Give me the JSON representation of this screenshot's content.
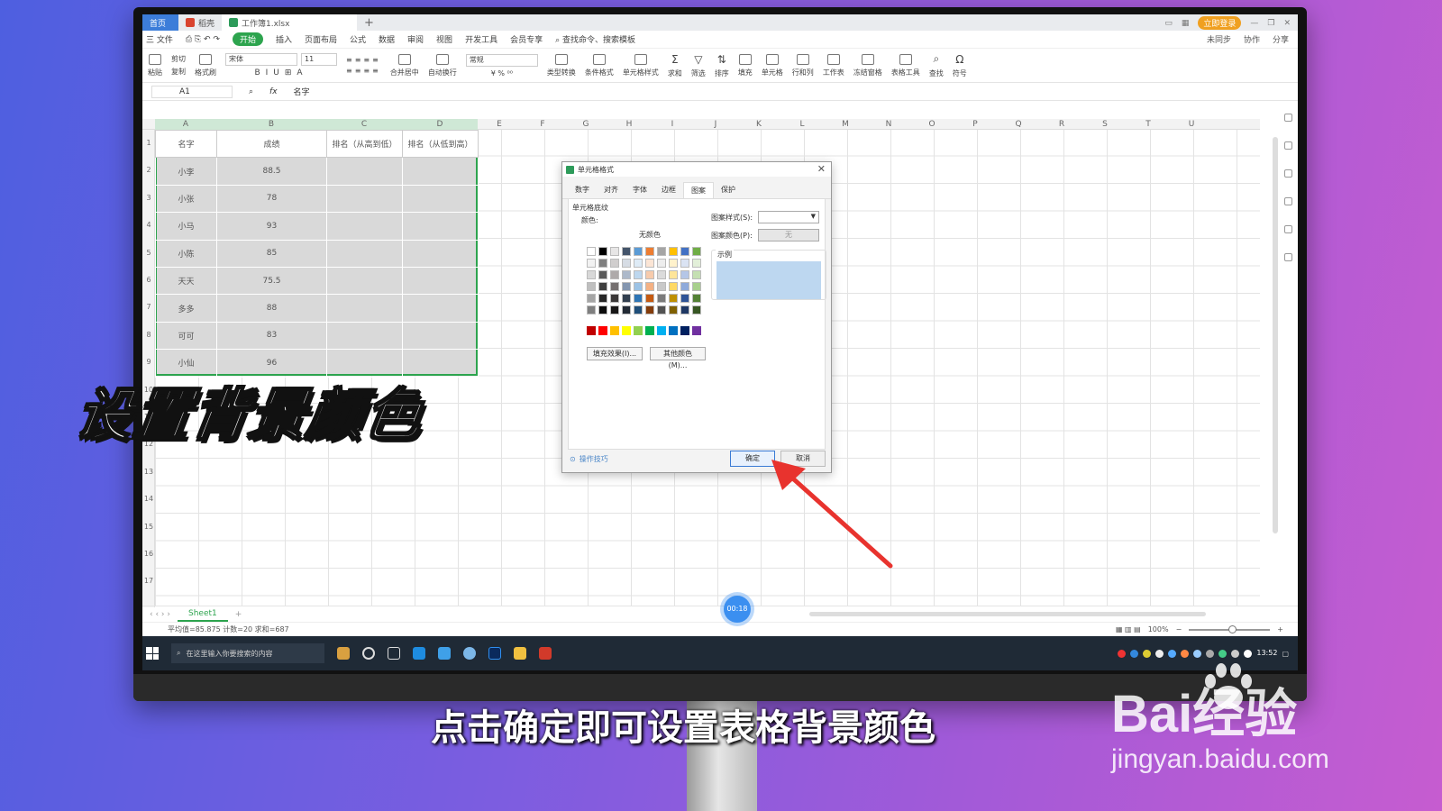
{
  "tabs": [
    {
      "label": "首页"
    },
    {
      "label": "稻壳"
    },
    {
      "label": "工作簿1.xlsx"
    }
  ],
  "window": {
    "login_label": "立即登录"
  },
  "menu": {
    "items": [
      "三 文件",
      "开始",
      "插入",
      "页面布局",
      "公式",
      "数据",
      "审阅",
      "视图",
      "开发工具",
      "会员专享"
    ],
    "search_placeholder": "查找命令、搜索模板",
    "right": [
      "未同步",
      "协作",
      "分享"
    ]
  },
  "ribbon": {
    "items": [
      "粘贴",
      "剪切",
      "复制",
      "格式刷",
      "合并居中",
      "自动换行",
      "类型转换",
      "条件格式",
      "单元格样式",
      "求和",
      "筛选",
      "排序",
      "填充",
      "单元格",
      "行和列",
      "工作表",
      "冻结窗格",
      "表格工具",
      "查找",
      "符号"
    ],
    "font_name": "宋体",
    "font_size": "11",
    "number_format": "常规"
  },
  "formula": {
    "namebox": "A1",
    "fx": "fx",
    "value": "名字"
  },
  "columns": [
    "A",
    "B",
    "C",
    "D",
    "E",
    "F",
    "G",
    "H",
    "I",
    "J",
    "K",
    "L",
    "M",
    "N",
    "O",
    "P",
    "Q",
    "R",
    "S",
    "T",
    "U"
  ],
  "rows": [
    "1",
    "2",
    "3",
    "4",
    "5",
    "6",
    "7",
    "8",
    "9",
    "10",
    "11",
    "12",
    "13",
    "14",
    "15",
    "16",
    "17"
  ],
  "table": {
    "headers": [
      "名字",
      "成绩",
      "排名（从高到低）",
      "排名（从低到高）"
    ],
    "rows": [
      [
        "小李",
        "88.5",
        "",
        ""
      ],
      [
        "小张",
        "78",
        "",
        ""
      ],
      [
        "小马",
        "93",
        "",
        ""
      ],
      [
        "小陈",
        "85",
        "",
        ""
      ],
      [
        "天天",
        "75.5",
        "",
        ""
      ],
      [
        "多多",
        "88",
        "",
        ""
      ],
      [
        "可可",
        "83",
        "",
        ""
      ],
      [
        "小仙",
        "96",
        "",
        ""
      ]
    ]
  },
  "sheet": {
    "tab": "Sheet1",
    "add": "+"
  },
  "status": {
    "stats": "平均值=85.875  计数=20  求和=687",
    "zoom": "100%"
  },
  "dialog": {
    "title": "单元格格式",
    "tabs": [
      "数字",
      "对齐",
      "字体",
      "边框",
      "图案",
      "保护"
    ],
    "section": "单元格底纹",
    "color_label": "颜色:",
    "no_fill": "无颜色",
    "fill_effects": "填充效果(I)...",
    "more_colors": "其他颜色(M)...",
    "pattern_style_label": "图案样式(S):",
    "pattern_color_label": "图案颜色(P):",
    "pattern_color_value": "无",
    "sample_label": "示例",
    "sample_color": "#bdd7f0",
    "tips": "操作技巧",
    "ok": "确定",
    "cancel": "取消"
  },
  "taskbar": {
    "search": "在这里输入你要搜索的内容",
    "time": "13:52"
  },
  "timer": "00:18",
  "caption_big": "设置背景颜色",
  "caption_sub": "点击确定即可设置表格背景颜色",
  "watermark": {
    "brand": "Bai经验",
    "url": "jingyan.baidu.com"
  },
  "palette_rows": [
    [
      "#ffffff",
      "#000000",
      "#e7e6e6",
      "#44546a",
      "#5b9bd5",
      "#ed7d31",
      "#a5a5a5",
      "#ffc000",
      "#4472c4",
      "#70ad47"
    ],
    [
      "#f2f2f2",
      "#7f7f7f",
      "#d0cece",
      "#d6dce4",
      "#deebf6",
      "#fbe5d5",
      "#ededed",
      "#fff2cc",
      "#dae3f3",
      "#e2efd9"
    ],
    [
      "#d8d8d8",
      "#595959",
      "#aeaaaa",
      "#adb9ca",
      "#bdd7ee",
      "#f7cbac",
      "#dbdbdb",
      "#fee599",
      "#b4c6e7",
      "#c5e0b3"
    ],
    [
      "#bfbfbf",
      "#3f3f3f",
      "#757070",
      "#8496b0",
      "#9cc3e5",
      "#f4b183",
      "#c9c9c9",
      "#ffd965",
      "#8eaadb",
      "#a8d08d"
    ],
    [
      "#a5a5a5",
      "#262626",
      "#3a3838",
      "#323f4f",
      "#2e75b5",
      "#c55a11",
      "#7b7b7b",
      "#bf9000",
      "#2f5496",
      "#538135"
    ],
    [
      "#7f7f7f",
      "#0c0c0c",
      "#171616",
      "#222a35",
      "#1f4e79",
      "#833c0b",
      "#525252",
      "#7f6000",
      "#1f3864",
      "#375623"
    ]
  ],
  "standard_colors": [
    "#c00000",
    "#ff0000",
    "#ffc000",
    "#ffff00",
    "#92d050",
    "#00b050",
    "#00b0f0",
    "#0070c0",
    "#002060",
    "#7030a0"
  ]
}
